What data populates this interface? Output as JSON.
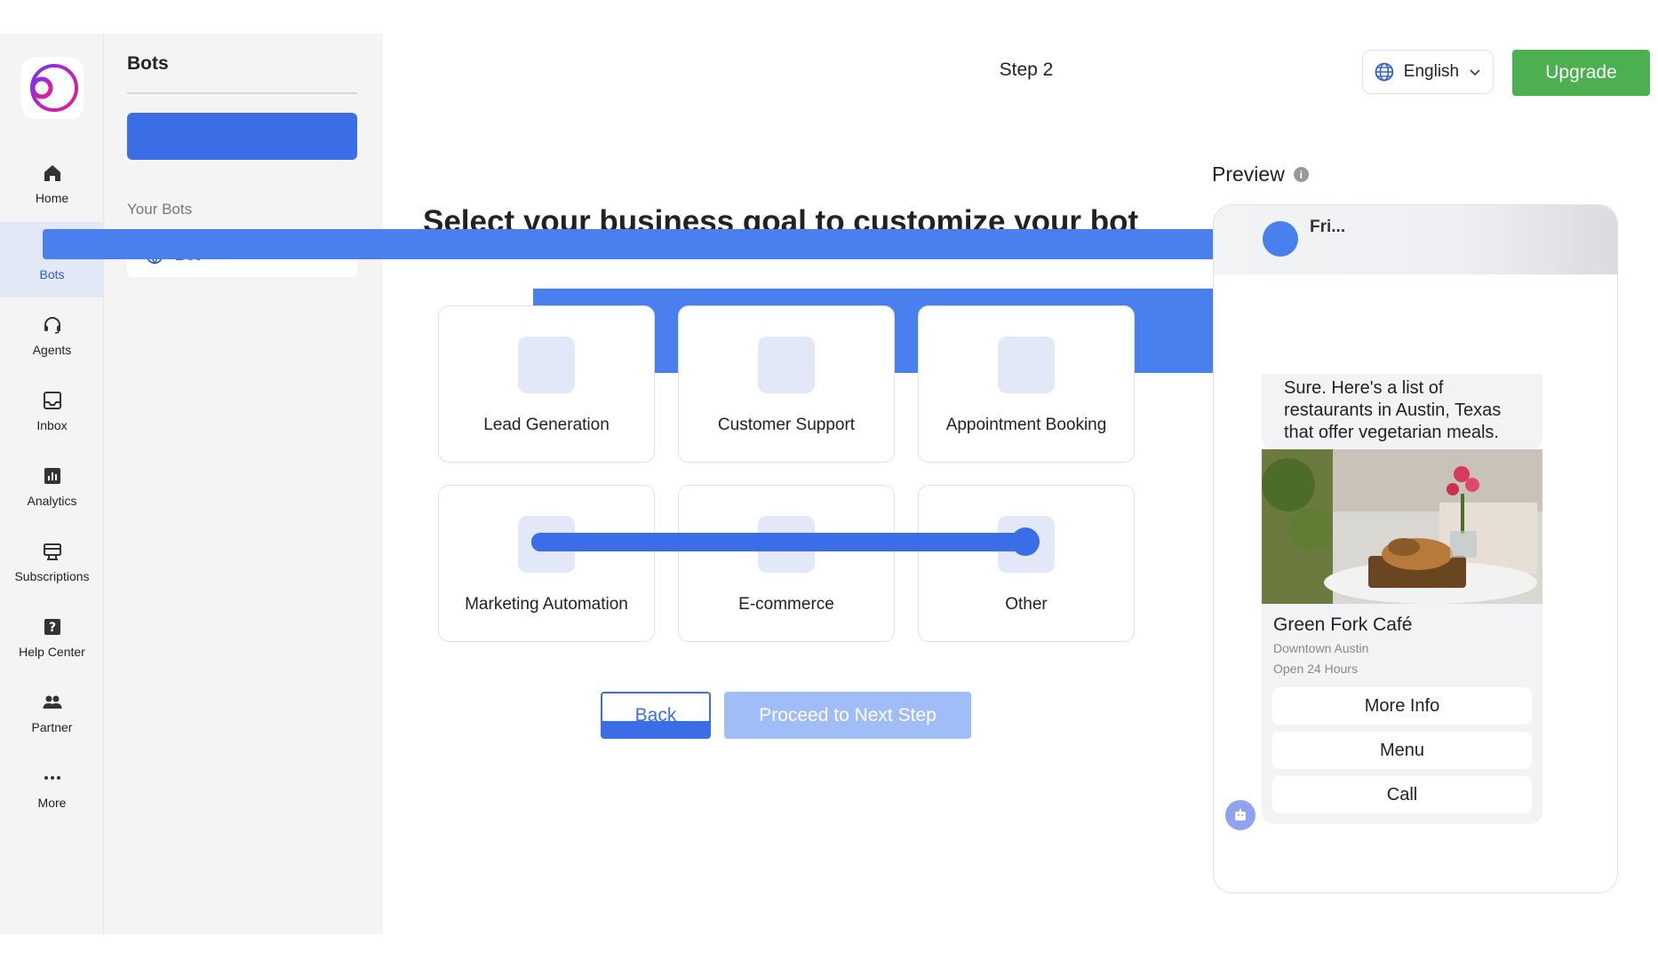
{
  "nav": {
    "items": [
      {
        "label": "Home",
        "icon": "home-icon"
      },
      {
        "label": "Bots",
        "icon": "bot-icon",
        "active": true
      },
      {
        "label": "Agents",
        "icon": "headset-icon"
      },
      {
        "label": "Inbox",
        "icon": "inbox-icon"
      },
      {
        "label": "Analytics",
        "icon": "analytics-icon"
      },
      {
        "label": "Subscriptions",
        "icon": "subscriptions-icon"
      },
      {
        "label": "Help Center",
        "icon": "help-icon"
      },
      {
        "label": "Partner",
        "icon": "partner-icon"
      },
      {
        "label": "More",
        "icon": "more-icon"
      }
    ]
  },
  "bots_panel": {
    "title": "Bots",
    "section_label": "Your Bots",
    "first_bot_fragment": "Bot"
  },
  "header": {
    "step": "Step 2",
    "language": "English",
    "upgrade": "Upgrade"
  },
  "main": {
    "heading": "Select your business goal to customize your bot",
    "goals": [
      {
        "label": "Lead Generation"
      },
      {
        "label": "Customer Support"
      },
      {
        "label": "Appointment Booking"
      },
      {
        "label": "Marketing Automation"
      },
      {
        "label": "E-commerce"
      },
      {
        "label": "Other"
      }
    ],
    "back": "Back",
    "next": "Proceed to Next Step"
  },
  "preview": {
    "title": "Preview",
    "bot_name_fragment": "Fri...",
    "message": "Sure. Here's a list of restaurants in Austin, Texas that offer vegetarian meals.",
    "card": {
      "title": "Green Fork Café",
      "location": "Downtown Austin",
      "hours": "Open 24 Hours",
      "buttons": [
        "More Info",
        "Menu",
        "Call"
      ]
    }
  },
  "colors": {
    "primary": "#3b6ee6",
    "redaction": "#4a7fee",
    "upgrade": "#4caf50",
    "next_disabled": "#a1bdf7",
    "rail_bg": "#f4f4f5",
    "active_nav_bg": "#e3e8f6"
  }
}
